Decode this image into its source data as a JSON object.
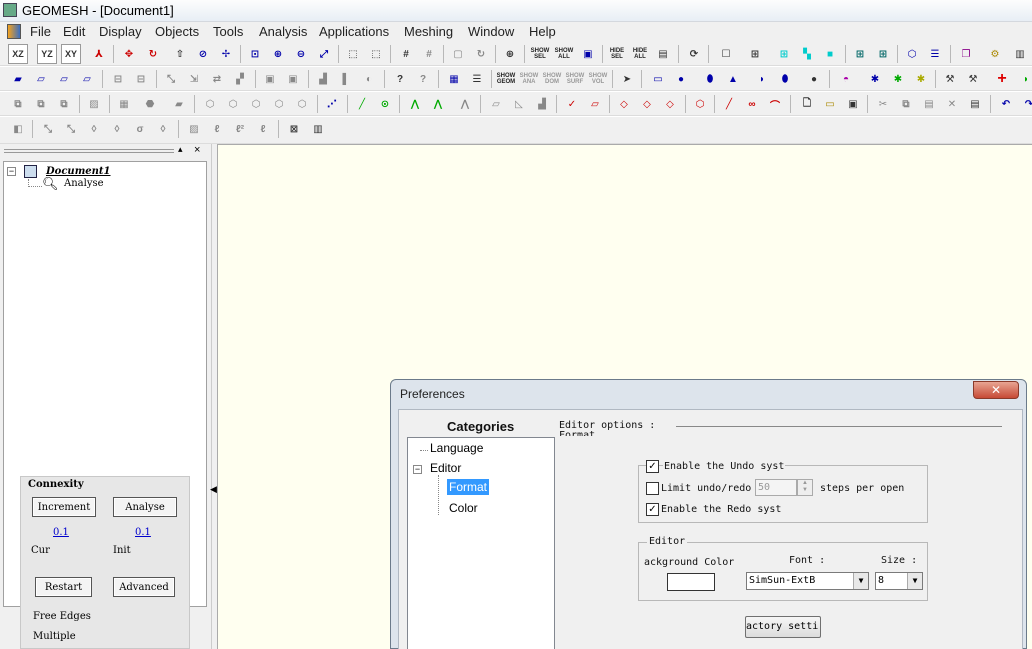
{
  "window": {
    "title": "GEOMESH - [Document1]"
  },
  "menu": [
    "File",
    "Edit",
    "Display",
    "Objects",
    "Tools",
    "Analysis",
    "Applications",
    "Meshing",
    "Window",
    "Help"
  ],
  "toolbar": {
    "xz": "XZ",
    "yz": "YZ",
    "xy": "XY",
    "show_sel": [
      "SHOW",
      "SEL"
    ],
    "show_all": [
      "SHOW",
      "ALL"
    ],
    "hide_sel": [
      "HIDE",
      "SEL"
    ],
    "hide_all": [
      "HIDE",
      "ALL"
    ],
    "show_geom": [
      "SHOW",
      "GEOM"
    ],
    "show_ana": [
      "SHOW",
      "ANA"
    ],
    "show_dom": [
      "SHOW",
      "DOM"
    ],
    "show_surf": [
      "SHOW",
      "SURF"
    ],
    "show_vol": [
      "SHOW",
      "VOL"
    ]
  },
  "tree": {
    "document": "Document1",
    "analyse": "Analyse"
  },
  "connexity": {
    "title": "Connexity",
    "increment": "Increment",
    "analyse": "Analyse",
    "cur_value": "0.1",
    "init_value": "0.1",
    "cur": "Cur",
    "init": "Init",
    "restart": "Restart",
    "advanced": "Advanced",
    "free_edges": "Free Edges",
    "multiple": "Multiple"
  },
  "dialog": {
    "title": "Preferences",
    "close": "✕",
    "categories": "Categories",
    "items": {
      "language": "Language",
      "editor": "Editor",
      "format": "Format",
      "color": "Color"
    },
    "editor_options": "Editor options :",
    "editor_options_sub": "Format",
    "enable_undo": "Enable the Undo syst",
    "limit_undo": "Limit undo/redo",
    "steps_value": "50",
    "steps_per_open": "steps per open",
    "enable_redo": "Enable the Redo syst",
    "editor_group": "Editor",
    "background_color": "ackground Color",
    "font_label": "Font :",
    "size_label": "Size :",
    "font_value": "SimSun-ExtB",
    "size_value": "8",
    "factory": "actory settir"
  },
  "colors": {
    "viewport": "#fffff0",
    "selection": "#3399ff"
  }
}
